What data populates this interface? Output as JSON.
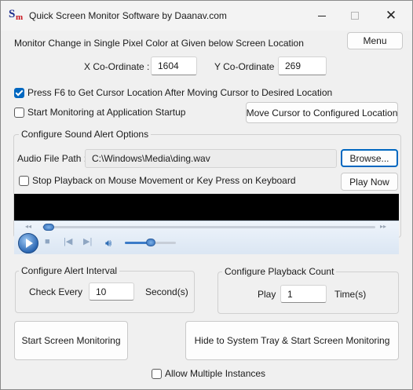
{
  "window": {
    "title": "Quick Screen Monitor Software by Daanav.com",
    "logo_s": "S",
    "logo_m": "m",
    "close_glyph": "✕"
  },
  "monitor": {
    "description": "Monitor Change in Single Pixel Color at Given below Screen Location",
    "menu_label": "Menu",
    "x_label": "X Co-Ordinate :",
    "x_value": "1604",
    "y_label": "Y Co-Ordinate :",
    "y_value": "269",
    "f6_label": "Press F6 to Get Cursor Location After Moving Cursor to Desired Location",
    "f6_checked": true,
    "startup_label": "Start Monitoring at Application Startup",
    "startup_checked": false,
    "move_cursor_label": "Move Cursor to Configured Location"
  },
  "sound": {
    "group_label": "Configure Sound Alert Options",
    "path_label": "Audio File Path :",
    "path_value": "C:\\Windows\\Media\\ding.wav",
    "browse_label": "Browse...",
    "stop_label": "Stop Playback on Mouse Movement or Key Press on Keyboard",
    "stop_checked": false,
    "play_now_label": "Play Now",
    "player": {
      "seek_position": 0.02,
      "volume_level": 0.5,
      "accent_color": "#2e6bb8",
      "icons": [
        "play-icon",
        "stop-icon",
        "previous-icon",
        "next-icon",
        "volume-icon"
      ]
    }
  },
  "interval": {
    "group_label": "Configure Alert Interval",
    "check_label": "Check Every",
    "value": "10",
    "unit": "Second(s)"
  },
  "playback": {
    "group_label": "Configure Playback Count",
    "play_label": "Play",
    "value": "1",
    "unit": "Time(s)"
  },
  "actions": {
    "start_label": "Start Screen Monitoring",
    "tray_label": "Hide to System Tray & Start Screen Monitoring",
    "multi_label": "Allow Multiple Instances",
    "multi_checked": false
  },
  "colors": {
    "accent": "#0067c0",
    "window_bg": "#f0f0f0"
  }
}
